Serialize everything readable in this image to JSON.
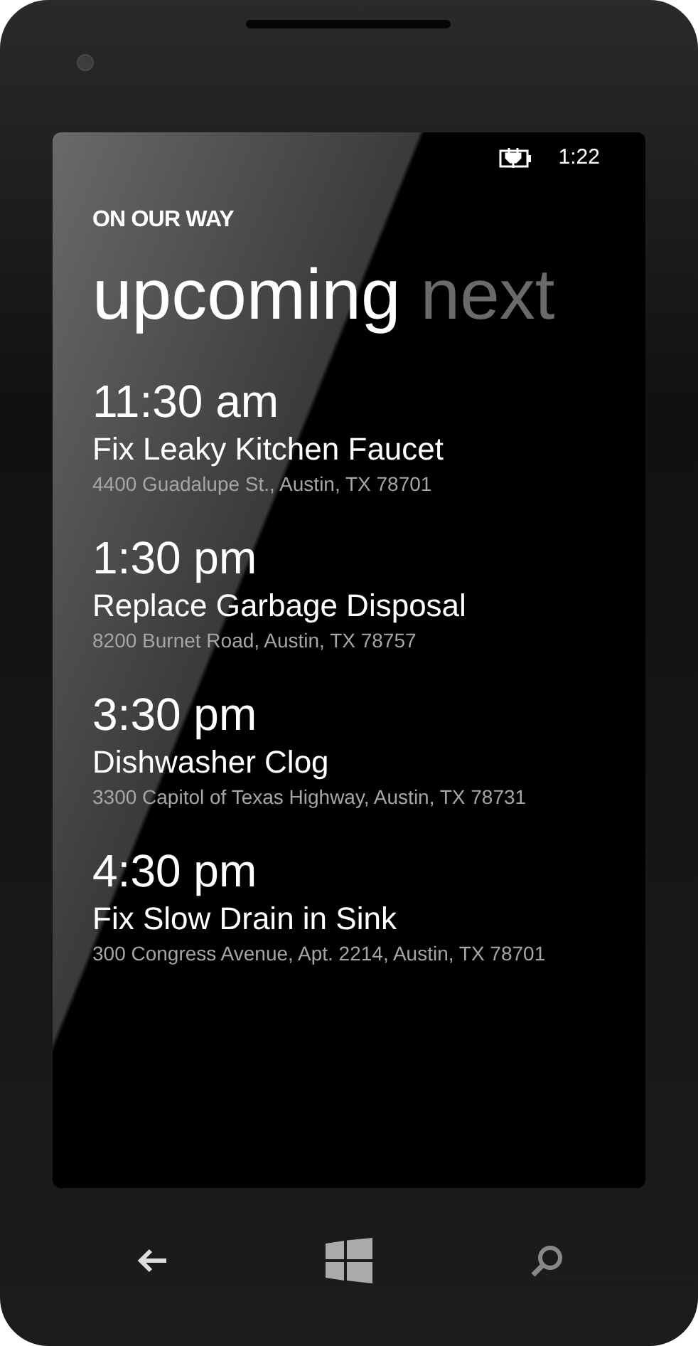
{
  "status_bar": {
    "time": "1:22"
  },
  "app_title": "ON OUR WAY",
  "pivot": [
    {
      "label": "upcoming",
      "selected": true
    },
    {
      "label": "next",
      "selected": false
    }
  ],
  "appointments": [
    {
      "time": "11:30 am",
      "title": "Fix Leaky Kitchen Faucet",
      "address": "4400 Guadalupe St., Austin, TX 78701"
    },
    {
      "time": "1:30 pm",
      "title": "Replace Garbage Disposal",
      "address": "8200 Burnet Road, Austin, TX 78757"
    },
    {
      "time": "3:30 pm",
      "title": "Dishwasher Clog",
      "address": "3300 Capitol of Texas Highway, Austin, TX 78731"
    },
    {
      "time": "4:30 pm",
      "title": "Fix Slow Drain in Sink",
      "address": "300 Congress Avenue, Apt. 2214, Austin, TX 78701"
    }
  ]
}
